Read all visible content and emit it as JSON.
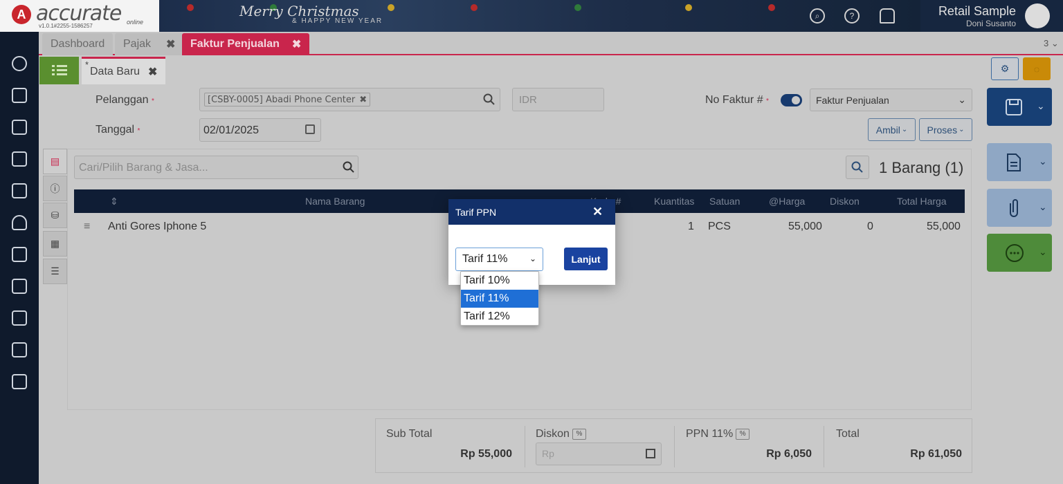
{
  "header": {
    "logo_text": "accurate",
    "logo_online": "online",
    "version": "v1.0.1#2255-1586257",
    "banner_title": "Merry Christmas",
    "banner_sub": "& HAPPY NEW YEAR",
    "company": "Retail Sample",
    "user": "Doni Susanto"
  },
  "tabs": [
    {
      "label": "Dashboard"
    },
    {
      "label": "Pajak",
      "close": "✖"
    },
    {
      "label": "Faktur Penjualan",
      "close": "✖"
    }
  ],
  "tab_count": "3 ⌄",
  "subtab": {
    "label": "Data Baru",
    "modified_mark": "*",
    "close": "✖"
  },
  "form": {
    "pelanggan_label": "Pelanggan",
    "required_mark": "*",
    "pelanggan_value": "[CSBY-0005] Abadi Phone Center",
    "chip_close": "✖",
    "currency": "IDR",
    "no_faktur_label": "No Faktur #",
    "faktur_type": "Faktur Penjualan",
    "tanggal_label": "Tanggal",
    "tanggal_value": "02/01/2025",
    "ambil_label": "Ambil",
    "proses_label": "Proses"
  },
  "items": {
    "search_placeholder": "Cari/Pilih Barang & Jasa...",
    "count_label": "1 Barang (1)",
    "columns": {
      "sort": "⇕",
      "nama": "Nama Barang",
      "kode": "Kode #",
      "kuantitas": "Kuantitas",
      "satuan": "Satuan",
      "harga": "@Harga",
      "diskon": "Diskon",
      "total": "Total Harga"
    },
    "rows": [
      {
        "handle": "≡",
        "nama": "Anti Gores Iphone 5",
        "kuantitas": "1",
        "satuan": "PCS",
        "harga": "55,000",
        "diskon": "0",
        "total": "55,000"
      }
    ]
  },
  "footer": {
    "subtotal_label": "Sub Total",
    "subtotal_value": "Rp 55,000",
    "diskon_label": "Diskon",
    "pct": "%",
    "diskon_placeholder": "Rp",
    "ppn_label": "PPN 11%",
    "ppn_value": "Rp 6,050",
    "total_label": "Total",
    "total_value": "Rp 61,050"
  },
  "dialog": {
    "title": "Tarif PPN",
    "close": "✕",
    "selected": "Tarif 11%",
    "button": "Lanjut",
    "options": [
      "Tarif 10%",
      "Tarif 11%",
      "Tarif 12%"
    ]
  },
  "colors": {
    "accent_red": "#c9254c",
    "navy": "#12306a",
    "option_highlight": "#1f6fd6"
  }
}
